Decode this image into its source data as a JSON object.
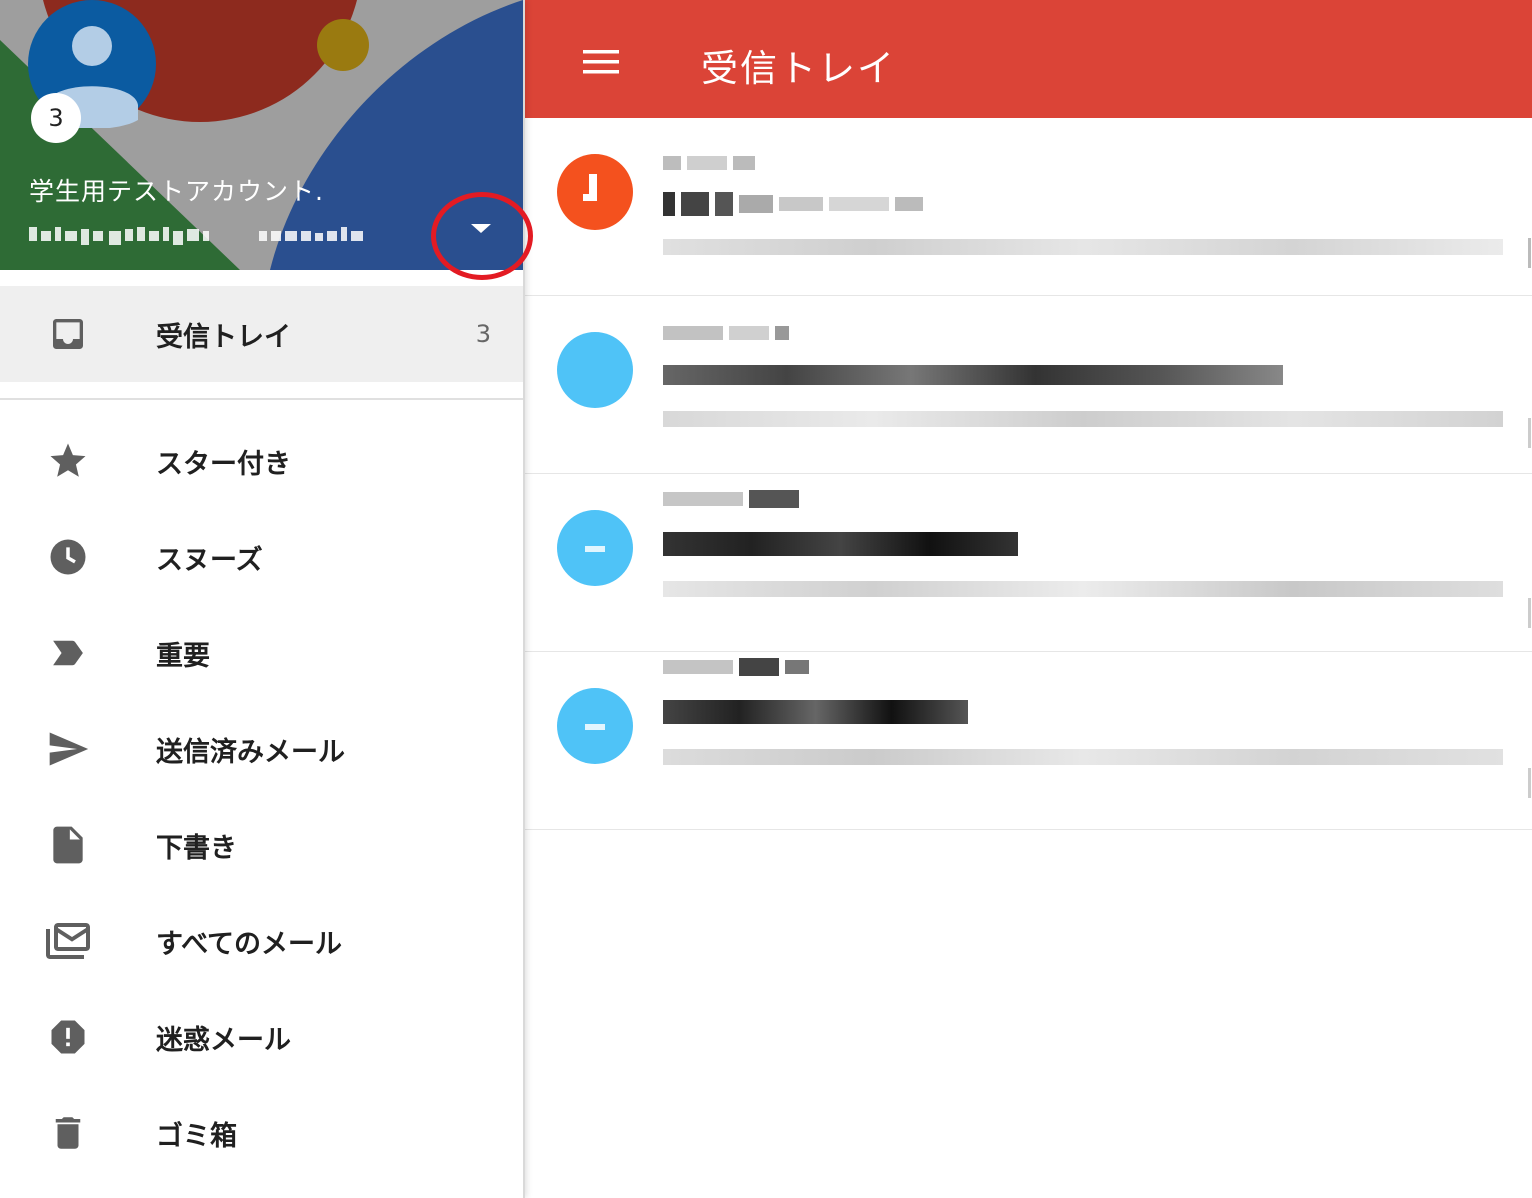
{
  "account": {
    "unread_badge": "3",
    "name": "学生用テストアカウント.",
    "email": "",
    "switch_icon": "arrow-drop-down-icon"
  },
  "appbar": {
    "title": "受信トレイ",
    "menu_icon": "hamburger-menu-icon"
  },
  "drawer": {
    "primary": {
      "label": "受信トレイ",
      "count": "3",
      "icon": "inbox-icon"
    },
    "items": [
      {
        "label": "スター付き",
        "icon": "star-icon"
      },
      {
        "label": "スヌーズ",
        "icon": "clock-icon"
      },
      {
        "label": "重要",
        "icon": "important-label-icon"
      },
      {
        "label": "送信済みメール",
        "icon": "send-icon"
      },
      {
        "label": "下書き",
        "icon": "draft-file-icon"
      },
      {
        "label": "すべてのメール",
        "icon": "all-mail-icon"
      },
      {
        "label": "迷惑メール",
        "icon": "spam-icon"
      },
      {
        "label": "ゴミ箱",
        "icon": "trash-icon"
      }
    ]
  },
  "colors": {
    "appbar": "#db4437",
    "highlight_ring": "#e31b23",
    "avatar_orange": "#f4511e",
    "avatar_blue": "#4fc3f7"
  },
  "messages": [
    {
      "avatar_color": "#f4511e"
    },
    {
      "avatar_color": "#4fc3f7"
    },
    {
      "avatar_color": "#4fc3f7"
    },
    {
      "avatar_color": "#4fc3f7"
    }
  ]
}
